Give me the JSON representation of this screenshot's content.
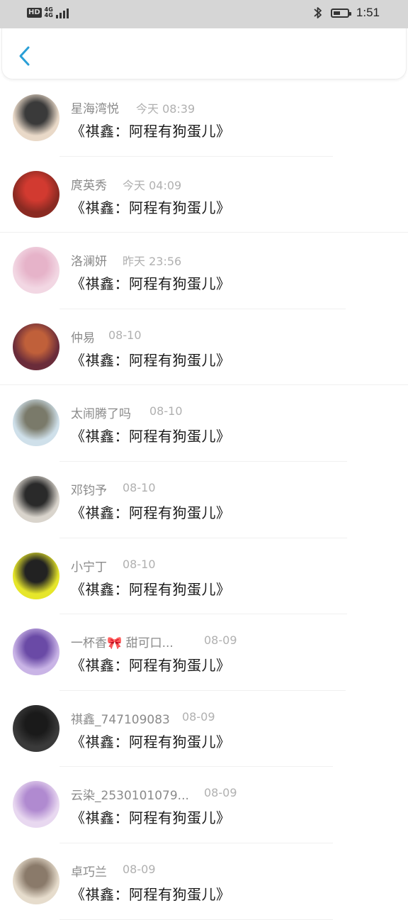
{
  "status_bar": {
    "hd": "HD",
    "network_top": "4G",
    "network_bottom": "4G",
    "time": "1:51",
    "battery_level": 0.5
  },
  "header": {
    "back_icon": "chevron-left-icon",
    "accent": "#2a9fd6"
  },
  "messages": [
    {
      "name": "星海湾悦",
      "time": "今天 08:39",
      "text": "《祺鑫：阿程有狗蛋儿》",
      "avatar_colors": [
        "#e9d9c8",
        "#3a3a3a"
      ]
    },
    {
      "name": "庹英秀",
      "time": "今天 04:09",
      "text": "《祺鑫：阿程有狗蛋儿》",
      "avatar_colors": [
        "#8a2a22",
        "#d23a30"
      ]
    },
    {
      "name": "洛澜妍",
      "time": "昨天 23:56",
      "text": "《祺鑫：阿程有狗蛋儿》",
      "avatar_colors": [
        "#f2d7e3",
        "#e6b3c9"
      ]
    },
    {
      "name": "仲易",
      "time": "08-10",
      "text": "《祺鑫：阿程有狗蛋儿》",
      "avatar_colors": [
        "#6a2c3a",
        "#c0603a"
      ]
    },
    {
      "name": "太闹腾了吗",
      "time": "08-10",
      "text": "《祺鑫：阿程有狗蛋儿》",
      "avatar_colors": [
        "#cfe0ea",
        "#7a7a6a"
      ]
    },
    {
      "name": "邓钧予",
      "time": "08-10",
      "text": "《祺鑫：阿程有狗蛋儿》",
      "avatar_colors": [
        "#d9d4cc",
        "#2a2a2a"
      ]
    },
    {
      "name": "小宁丁",
      "time": "08-10",
      "text": "《祺鑫：阿程有狗蛋儿》",
      "avatar_colors": [
        "#e6e62a",
        "#222222"
      ]
    },
    {
      "name": "一杯香🎀 甜可口...",
      "time": "08-09",
      "text": "《祺鑫：阿程有狗蛋儿》",
      "avatar_colors": [
        "#c9b4e6",
        "#6a4aa6"
      ]
    },
    {
      "name": "祺鑫_747109083",
      "time": "08-09",
      "text": "《祺鑫：阿程有狗蛋儿》",
      "avatar_colors": [
        "#3a3a3a",
        "#1a1a1a"
      ]
    },
    {
      "name": "云染_2530101079...",
      "time": "08-09",
      "text": "《祺鑫：阿程有狗蛋儿》",
      "avatar_colors": [
        "#e8d8f0",
        "#b08ad0"
      ]
    },
    {
      "name": "卓巧兰",
      "time": "08-09",
      "text": "《祺鑫：阿程有狗蛋儿》",
      "avatar_colors": [
        "#e6dccc",
        "#8a7a6a"
      ]
    }
  ]
}
